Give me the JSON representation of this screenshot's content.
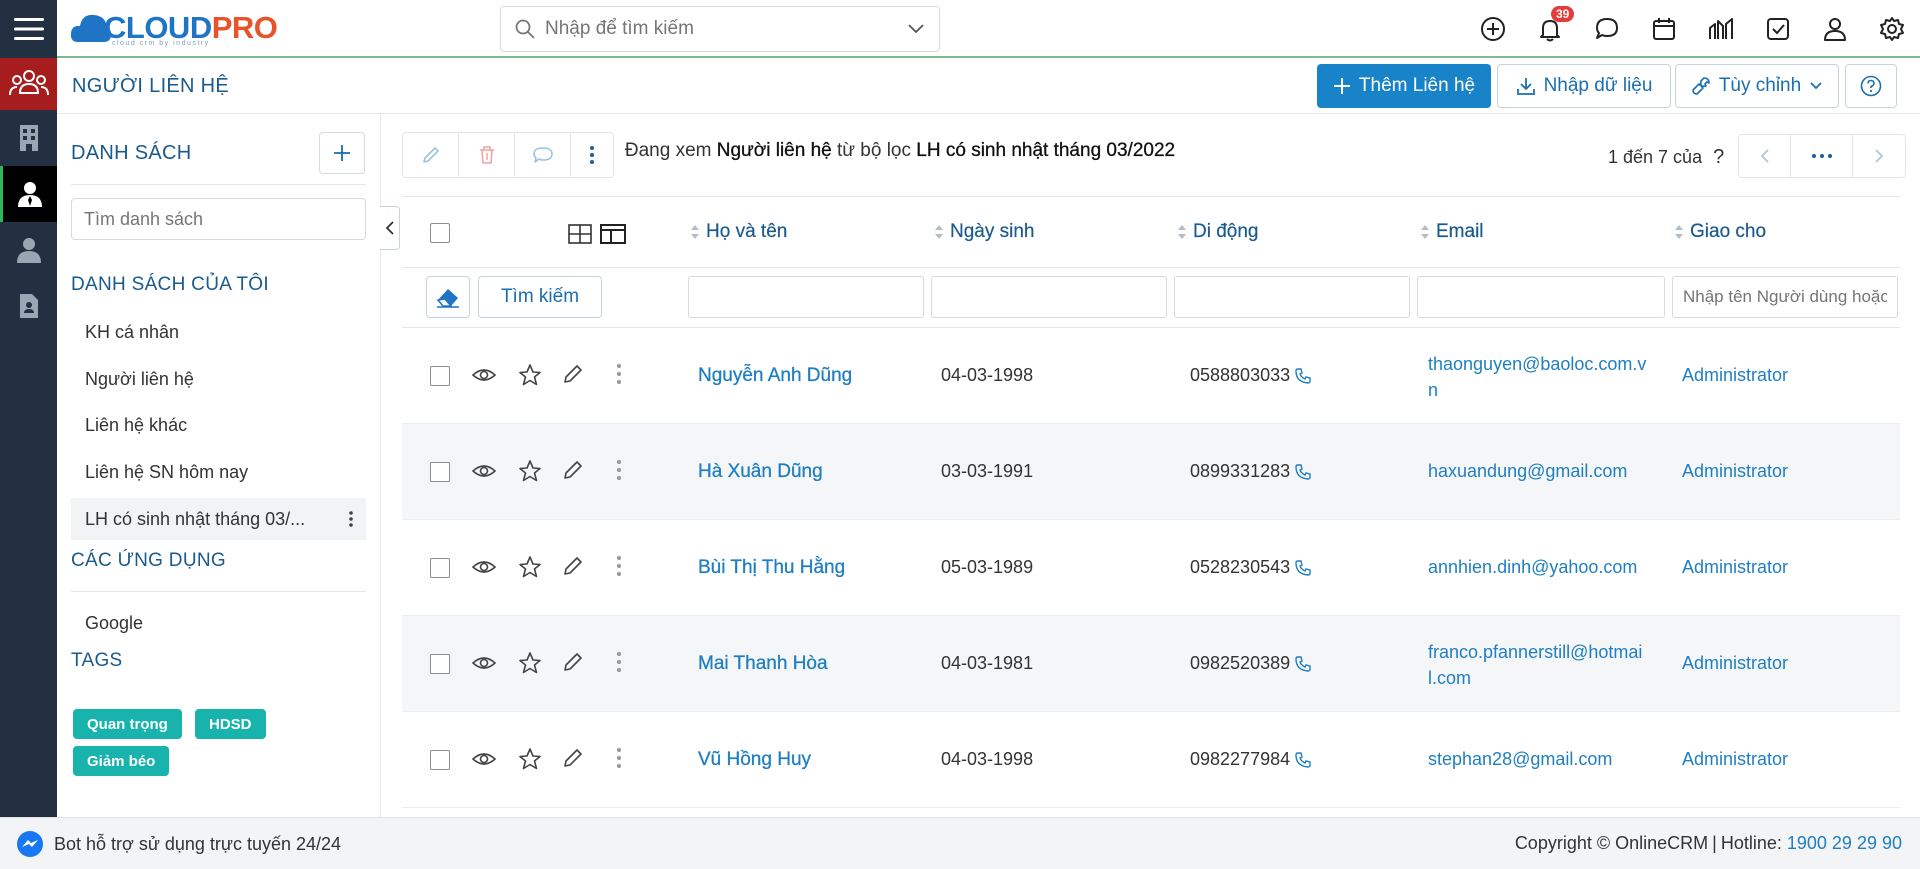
{
  "header": {
    "logo_cloud": "CLOUD",
    "logo_pro": "PRO",
    "logo_tagline": "cloud crm by industry",
    "search_placeholder": "Nhập để tìm kiếm",
    "notification_count": "39"
  },
  "page": {
    "title": "NGƯỜI LIÊN HỆ",
    "add_button": "Thêm Liên hệ",
    "import_button": "Nhập dữ liệu",
    "customize_button": "Tùy chỉnh"
  },
  "lists": {
    "heading": "DANH SÁCH",
    "search_placeholder": "Tìm danh sách",
    "my_lists_heading": "DANH SÁCH CỦA TÔI",
    "items": [
      {
        "label": "KH cá nhân"
      },
      {
        "label": "Người liên hệ"
      },
      {
        "label": "Liên hệ khác"
      },
      {
        "label": "Liên hệ SN hôm nay"
      },
      {
        "label": "LH có sinh nhật tháng 03/..."
      }
    ],
    "apps_heading": "CÁC ỨNG DỤNG",
    "apps": [
      {
        "label": "Google"
      }
    ],
    "tags_heading": "TAGS",
    "tags": [
      {
        "label": "Quan trọng"
      },
      {
        "label": "HDSD"
      },
      {
        "label": "Giảm béo"
      }
    ]
  },
  "view": {
    "prefix": "Đang xem ",
    "module": "Người liên hệ",
    "middle": " từ bộ lọc ",
    "filter": "LH có sinh nhật tháng 03/2022",
    "paging": "1 đến 7 của",
    "paging_unknown": "?"
  },
  "table": {
    "columns": [
      "Họ và tên",
      "Ngày sinh",
      "Di động",
      "Email",
      "Giao cho"
    ],
    "search_button": "Tìm kiếm",
    "assignee_filter_placeholder": "Nhập tên Người dùng hoặc",
    "rows": [
      {
        "name": "Nguyễn Anh Dũng",
        "dob": "04-03-1998",
        "phone": "0588803033",
        "email_line1": "thaonguyen@baoloc.com.v",
        "email_line2": "n",
        "assignee": "Administrator"
      },
      {
        "name": "Hà Xuân Dũng",
        "dob": "03-03-1991",
        "phone": "0899331283",
        "email_line1": "haxuandung@gmail.com",
        "email_line2": "",
        "assignee": "Administrator"
      },
      {
        "name": "Bùi Thị Thu Hằng",
        "dob": "05-03-1989",
        "phone": "0528230543",
        "email_line1": "annhien.dinh@yahoo.com",
        "email_line2": "",
        "assignee": "Administrator"
      },
      {
        "name": "Mai Thanh Hòa",
        "dob": "04-03-1981",
        "phone": "0982520389",
        "email_line1": "franco.pfannerstill@hotmai",
        "email_line2": "l.com",
        "assignee": "Administrator"
      },
      {
        "name": "Vũ Hồng Huy",
        "dob": "04-03-1998",
        "phone": "0982277984",
        "email_line1": "stephan28@gmail.com",
        "email_line2": "",
        "assignee": "Administrator"
      }
    ]
  },
  "footer": {
    "bot_text": "Bot hỗ trợ sử dụng trực tuyến 24/24",
    "copyright": "Copyright © OnlineCRM",
    "sep": "|",
    "hotline_label": "Hotline: ",
    "hotline": "1900 29 29 90"
  },
  "colors": {
    "primary": "#1883c8",
    "heading": "#1a5a8c",
    "link": "#1f7fc1",
    "sidebar": "#223041",
    "tag": "#17b3ac",
    "badge": "#e43b3b"
  }
}
